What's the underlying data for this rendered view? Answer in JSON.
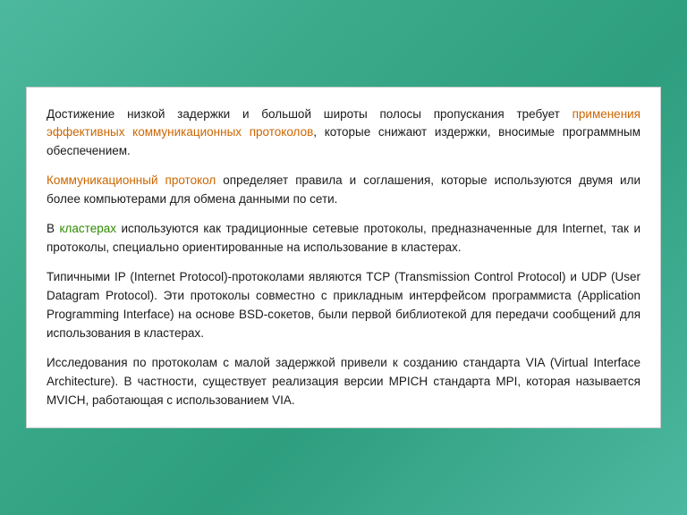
{
  "content": {
    "paragraphs": [
      {
        "id": "p1",
        "parts": [
          {
            "text": "Достижение низкой задержки и большой широты полосы пропускания требует ",
            "style": "normal"
          },
          {
            "text": "применения эффективных коммуникационных протоколов",
            "style": "orange"
          },
          {
            "text": ", которые снижают издержки, вносимые программным обеспечением.",
            "style": "normal"
          }
        ]
      },
      {
        "id": "p2",
        "parts": [
          {
            "text": "Коммуникационный протокол",
            "style": "orange"
          },
          {
            "text": " определяет правила и соглашения, которые используются двумя или более компьютерами для обмена данными по сети.",
            "style": "normal"
          }
        ]
      },
      {
        "id": "p3",
        "parts": [
          {
            "text": "В ",
            "style": "normal"
          },
          {
            "text": "кластерах",
            "style": "green"
          },
          {
            "text": " используются как традиционные сетевые протоколы, предназначенные для Internet, так и протоколы, специально ориентированные на использование в кластерах.",
            "style": "normal"
          }
        ]
      },
      {
        "id": "p4",
        "parts": [
          {
            "text": "Типичными IP (Internet Protocol)-протоколами являются TCP (Transmission Control Protocol) и UDP (User Datagram Protocol). Эти протоколы совместно с прикладным интерфейсом программиста (Application Programming Interface) на основе BSD-сокетов, были первой библиотекой для передачи сообщений для использования в кластерах.",
            "style": "normal"
          }
        ]
      },
      {
        "id": "p5",
        "parts": [
          {
            "text": "Исследования по протоколам с малой задержкой привели к созданию стандарта VIA (Virtual Interface Architecture). В частности, существует реализация версии MPICH стандарта MPI, которая называется MVICH, работающая с использованием VIA.",
            "style": "normal"
          }
        ]
      }
    ]
  }
}
